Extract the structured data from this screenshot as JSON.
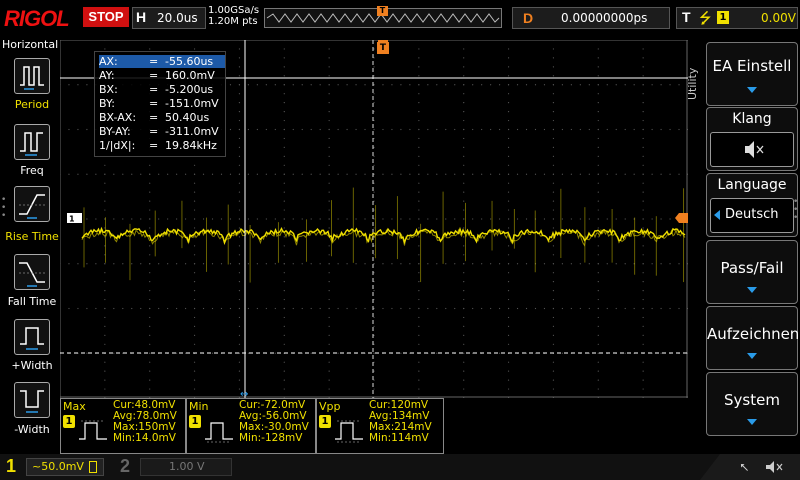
{
  "header": {
    "logo": "RIGOL",
    "run_state": "STOP",
    "h_label": "H",
    "timebase": "20.0us",
    "sample_rate": "1.00GSa/s",
    "memory_depth": "1.20M pts",
    "trigger_marker": "T",
    "delay_label": "D",
    "delay_value": "0.00000000ps",
    "trig_label": "T",
    "trig_slope": "⭍",
    "trig_channel": "1",
    "trig_level": "0.00V"
  },
  "left_panel": {
    "title": "Horizontal",
    "items": [
      {
        "label": "Period",
        "icon": "period-icon"
      },
      {
        "label": "Freq",
        "icon": "freq-icon"
      },
      {
        "label": "Rise Time",
        "icon": "rise-time-icon"
      },
      {
        "label": "Fall Time",
        "icon": "fall-time-icon"
      },
      {
        "label": "+Width",
        "icon": "plus-width-icon"
      },
      {
        "label": "-Width",
        "icon": "minus-width-icon"
      }
    ]
  },
  "right_menu": {
    "utility_tab": "Utility",
    "ea_einstell": "EA Einstell",
    "klang_title": "Klang",
    "klang_icon": "🔈̸",
    "language_title": "Language",
    "language_value": "Deutsch",
    "passfail": "Pass/Fail",
    "aufzeichnen": "Aufzeichnen",
    "system": "System"
  },
  "cursors": {
    "rows": [
      {
        "key": "AX:",
        "eq": "=",
        "val": "-55.60us"
      },
      {
        "key": "AY:",
        "eq": "=",
        "val": "160.0mV"
      },
      {
        "key": "BX:",
        "eq": "=",
        "val": "-5.200us"
      },
      {
        "key": "BY:",
        "eq": "=",
        "val": "-151.0mV"
      },
      {
        "key": "BX-AX:",
        "eq": "=",
        "val": "50.40us"
      },
      {
        "key": "BY-AY:",
        "eq": "=",
        "val": "-311.0mV"
      },
      {
        "key": "1/|dX|:",
        "eq": "=",
        "val": "19.84kHz"
      }
    ],
    "ch_marker": "1"
  },
  "measurements": [
    {
      "name": "Max",
      "ch": "1",
      "values": "Cur:48.0mV\nAvg:78.0mV\nMax:150mV\nMin:14.0mV"
    },
    {
      "name": "Min",
      "ch": "1",
      "values": "Cur:-72.0mV\nAvg:-56.0mV\nMax:-30.0mV\nMin:-128mV"
    },
    {
      "name": "Vpp",
      "ch": "1",
      "values": "Cur:120mV\nAvg:134mV\nMax:214mV\nMin:114mV"
    }
  ],
  "bottom": {
    "ch1_num": "1",
    "ch1_scale": "~50.0mV",
    "ch2_num": "2",
    "ch2_scale": "1.00 V"
  },
  "colors": {
    "trace": "#f0e000",
    "accent_orange": "#f08020",
    "menu_arrow": "#2a9be8",
    "stop_red": "#d01010"
  }
}
